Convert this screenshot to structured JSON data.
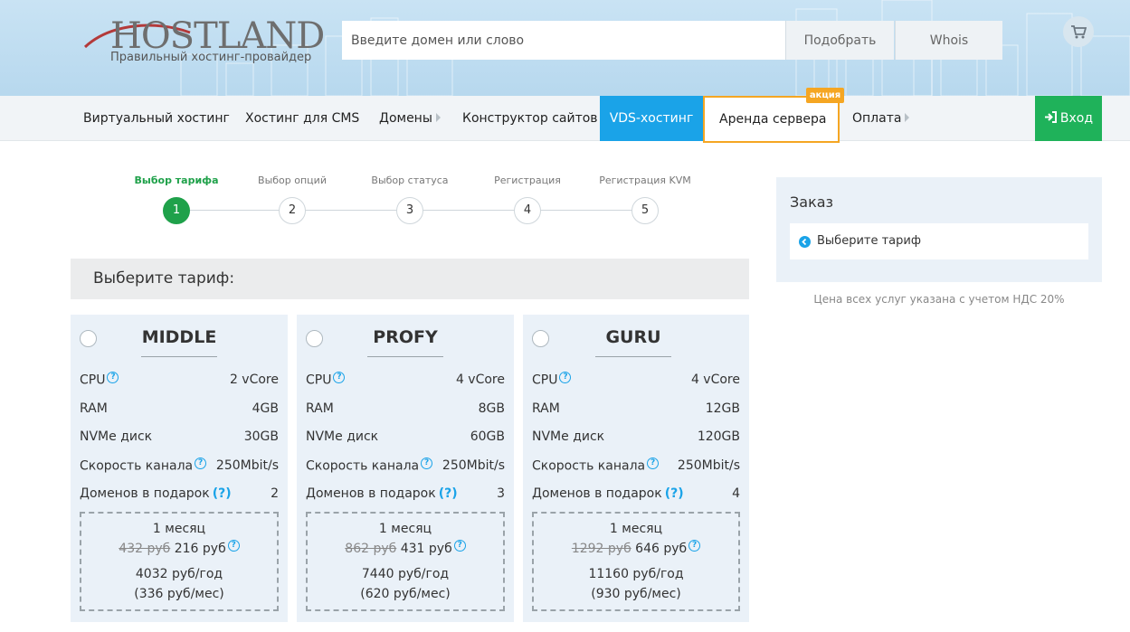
{
  "header": {
    "logo_text": "HOSTLAND",
    "logo_subtitle": "Правильный хостинг-провайдер",
    "search_placeholder": "Введите домен или слово",
    "pick_button": "Подобрать",
    "whois_button": "Whois"
  },
  "nav": {
    "items": [
      "Виртуальный хостинг",
      "Хостинг для CMS",
      "Домены",
      "Конструктор сайтов",
      "VDS-хостинг",
      "Аренда сервера",
      "Оплата"
    ],
    "promo_badge": "акция",
    "login": "Вход"
  },
  "steps": [
    {
      "label": "Выбор тарифа",
      "num": "1"
    },
    {
      "label": "Выбор опций",
      "num": "2"
    },
    {
      "label": "Выбор статуса",
      "num": "3"
    },
    {
      "label": "Регистрация",
      "num": "4"
    },
    {
      "label": "Регистрация KVM",
      "num": "5"
    }
  ],
  "choose_title": "Выберите тариф:",
  "spec_labels": {
    "cpu": "CPU",
    "ram": "RAM",
    "disk": "NVMe диск",
    "speed": "Скорость канала",
    "domains": "Доменов в подарок"
  },
  "tariffs": [
    {
      "name": "MIDDLE",
      "cpu": "2 vCore",
      "ram": "4GB",
      "disk": "30GB",
      "speed": "250Mbit/s",
      "domains": "2",
      "period": "1 месяц",
      "old_price": "432 руб",
      "price": "216 руб",
      "year": "4032 руб/год",
      "per_month": "(336 руб/мес)"
    },
    {
      "name": "PROFY",
      "cpu": "4 vCore",
      "ram": "8GB",
      "disk": "60GB",
      "speed": "250Mbit/s",
      "domains": "3",
      "period": "1 месяц",
      "old_price": "862 руб",
      "price": "431 руб",
      "year": "7440 руб/год",
      "per_month": "(620 руб/мес)"
    },
    {
      "name": "GURU",
      "cpu": "4 vCore",
      "ram": "12GB",
      "disk": "120GB",
      "speed": "250Mbit/s",
      "domains": "4",
      "period": "1 месяц",
      "old_price": "1292 руб",
      "price": "646 руб",
      "year": "11160 руб/год",
      "per_month": "(930 руб/мес)"
    }
  ],
  "order": {
    "title": "Заказ",
    "placeholder": "Выберите тариф",
    "vat_note": "Цена всех услуг указана с учетом НДС 20%"
  },
  "colors": {
    "accent_blue": "#1aa3e8",
    "accent_green": "#1fa14a",
    "promo_orange": "#f5a623"
  }
}
